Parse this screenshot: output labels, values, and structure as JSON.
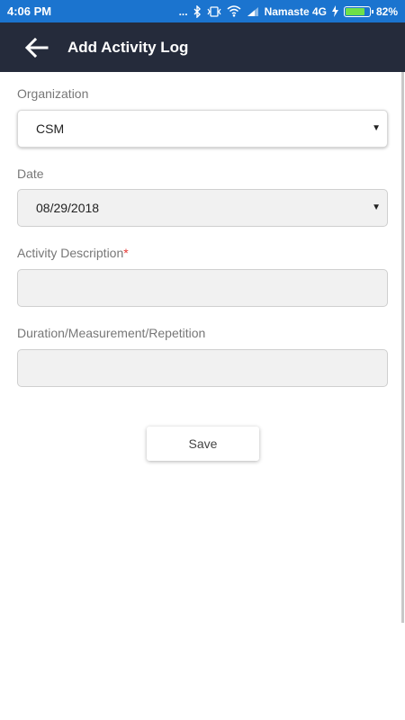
{
  "status_bar": {
    "time": "4:06 PM",
    "dots": "...",
    "carrier": "Namaste 4G",
    "battery_percent": "82%",
    "battery_level": 0.82,
    "icons": [
      "bluetooth-icon",
      "vibrate-icon",
      "wifi-icon",
      "signal-icon",
      "charging-icon",
      "battery-icon"
    ]
  },
  "app_bar": {
    "title": "Add Activity Log",
    "back_icon": "arrow-left-icon"
  },
  "form": {
    "organization": {
      "label": "Organization",
      "value": "CSM"
    },
    "date": {
      "label": "Date",
      "value": "08/29/2018"
    },
    "activity_description": {
      "label": "Activity Description",
      "required_mark": "*",
      "value": ""
    },
    "duration": {
      "label": "Duration/Measurement/Repetition",
      "value": ""
    },
    "dropdown_glyph": "▼"
  },
  "actions": {
    "save_label": "Save"
  },
  "colors": {
    "status_bar": "#1b74cf",
    "app_bar": "#252b3b",
    "required": "#e53935",
    "battery_fill": "#6ee04a"
  }
}
